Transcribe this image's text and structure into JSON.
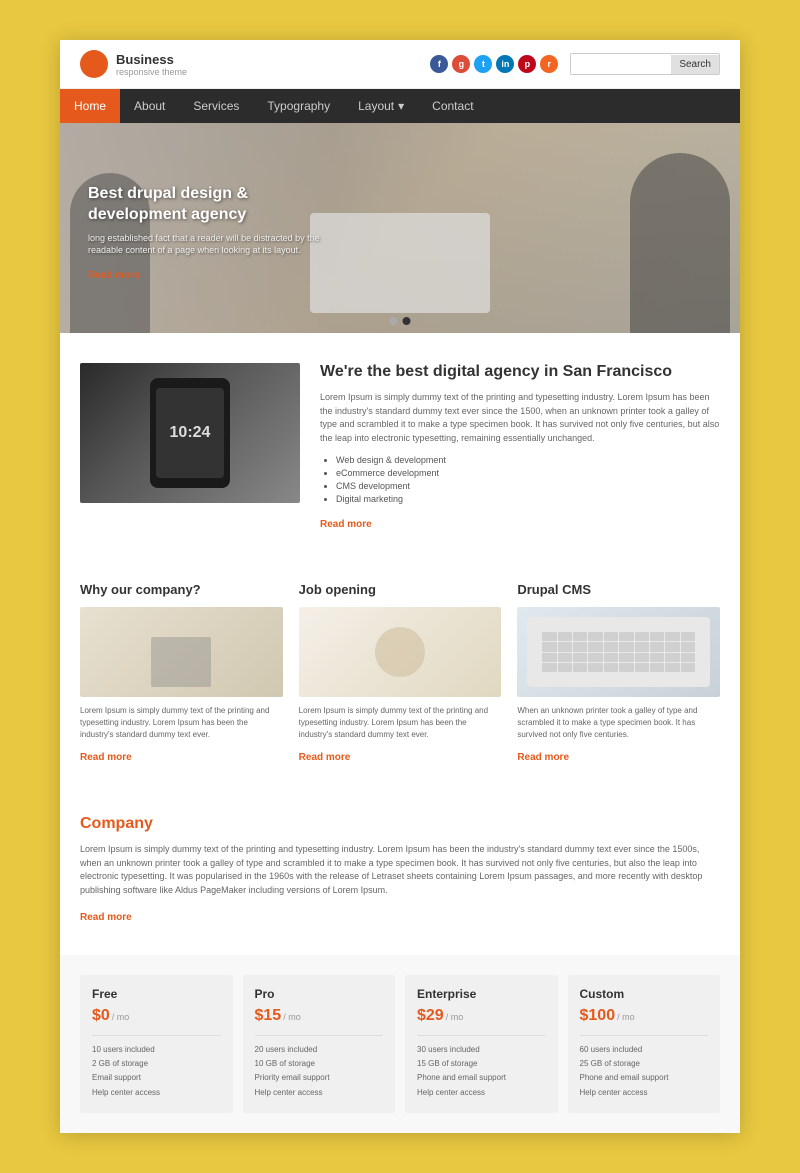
{
  "site": {
    "logo_title": "Business",
    "logo_subtitle": "responsive theme",
    "search_placeholder": "",
    "search_button": "Search"
  },
  "social_icons": [
    "f",
    "g+",
    "t",
    "in",
    "p",
    "rss"
  ],
  "nav": {
    "items": [
      {
        "label": "Home",
        "active": true
      },
      {
        "label": "About",
        "active": false
      },
      {
        "label": "Services",
        "active": false
      },
      {
        "label": "Typography",
        "active": false
      },
      {
        "label": "Layout",
        "active": false,
        "has_dropdown": true
      },
      {
        "label": "Contact",
        "active": false
      }
    ]
  },
  "hero": {
    "title": "Best drupal design & development agency",
    "description": "long established fact that a reader will be distracted by the readable content of a page when looking at its layout.",
    "readmore": "Read more",
    "dots": [
      1,
      2
    ]
  },
  "about": {
    "title": "We're the best digital agency in San Francisco",
    "text": "Lorem Ipsum is simply dummy text of the printing and typesetting industry. Lorem Ipsum has been the industry's standard dummy text ever since the 1500, when an unknown printer took a galley of type and scrambled it to make a type specimen book. It has survived not only five centuries, but also the leap into electronic typesetting, remaining essentially unchanged.",
    "list": [
      "Web design & development",
      "eCommerce development",
      "CMS development",
      "Digital marketing"
    ],
    "readmore": "Read more",
    "phone_time": "10:24"
  },
  "columns": [
    {
      "title": "Why our company?",
      "text": "Lorem Ipsum is simply dummy text of the printing and typesetting industry. Lorem Ipsum has been the industry's standard dummy text ever.",
      "readmore": "Read more"
    },
    {
      "title": "Job opening",
      "text": "Lorem Ipsum is simply dummy text of the printing and typesetting industry. Lorem Ipsum has been the industry's standard dummy text ever.",
      "readmore": "Read more"
    },
    {
      "title": "Drupal CMS",
      "text": "When an unknown printer took a galley of type and scrambled it to make a type specimen book. It has survived not only five centuries.",
      "readmore": "Read more"
    }
  ],
  "company": {
    "title": "Company",
    "text": "Lorem Ipsum is simply dummy text of the printing and typesetting industry. Lorem Ipsum has been the industry's standard dummy text ever since the 1500s, when an unknown printer took a galley of type and scrambled it to make a type specimen book. It has survived not only five centuries, but also the leap into electronic typesetting. It was popularised in the 1960s with the release of Letraset sheets containing Lorem Ipsum passages, and more recently with desktop publishing software like Aldus PageMaker including versions of Lorem Ipsum.",
    "readmore": "Read more"
  },
  "pricing": {
    "plans": [
      {
        "name": "Free",
        "price": "$0",
        "period": "/ mo",
        "features": [
          "10 users included",
          "2 GB of storage",
          "Email support",
          "Help center access"
        ]
      },
      {
        "name": "Pro",
        "price": "$15",
        "period": "/ mo",
        "features": [
          "20 users included",
          "10 GB of storage",
          "Priority email support",
          "Help center access"
        ]
      },
      {
        "name": "Enterprise",
        "price": "$29",
        "period": "/ mo",
        "features": [
          "30 users included",
          "15 GB of storage",
          "Phone and email support",
          "Help center access"
        ]
      },
      {
        "name": "Custom",
        "price": "$100",
        "period": "/ mo",
        "features": [
          "60 users included",
          "25 GB of storage",
          "Phone and email support",
          "Help center access"
        ]
      }
    ]
  }
}
